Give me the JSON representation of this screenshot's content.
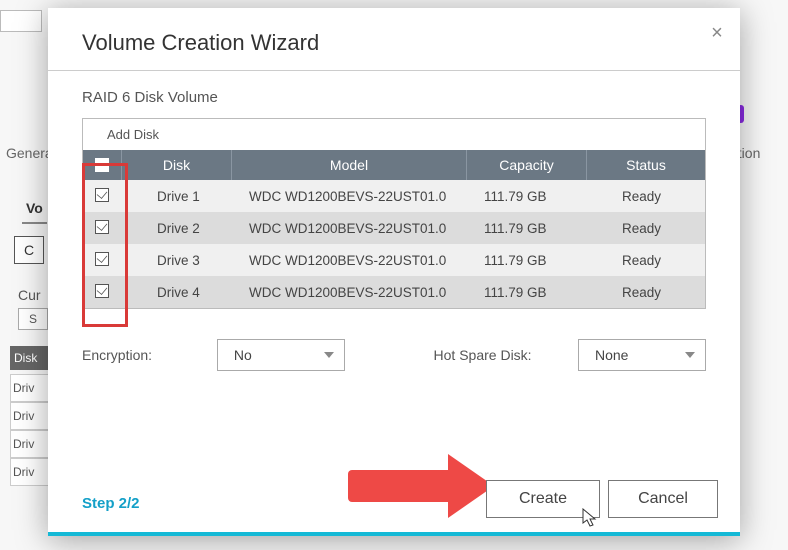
{
  "bg": {
    "general_label_fragment": "Genera",
    "ation_fragment": "ation",
    "vol_tab_fragment": "Vo",
    "c_button_fragment": "C",
    "curr_fragment": "Cur",
    "s_fragment": "S",
    "disk_fragment": "Disk",
    "drive_fragment": "Driv"
  },
  "dialog": {
    "title": "Volume Creation Wizard",
    "subtitle": "RAID 6 Disk Volume",
    "add_disk_label": "Add Disk",
    "columns": {
      "disk": "Disk",
      "model": "Model",
      "capacity": "Capacity",
      "status": "Status"
    },
    "select_all_checked": true,
    "rows": [
      {
        "checked": true,
        "disk": "Drive 1",
        "model": "WDC WD1200BEVS-22UST01.0",
        "capacity": "111.79 GB",
        "status": "Ready"
      },
      {
        "checked": true,
        "disk": "Drive 2",
        "model": "WDC WD1200BEVS-22UST01.0",
        "capacity": "111.79 GB",
        "status": "Ready"
      },
      {
        "checked": true,
        "disk": "Drive 3",
        "model": "WDC WD1200BEVS-22UST01.0",
        "capacity": "111.79 GB",
        "status": "Ready"
      },
      {
        "checked": true,
        "disk": "Drive 4",
        "model": "WDC WD1200BEVS-22UST01.0",
        "capacity": "111.79 GB",
        "status": "Ready"
      }
    ],
    "encryption_label": "Encryption:",
    "encryption_value": "No",
    "hotspare_label": "Hot Spare Disk:",
    "hotspare_value": "None",
    "step_label": "Step 2/2",
    "create_label": "Create",
    "cancel_label": "Cancel"
  },
  "colors": {
    "accent_teal": "#14b9d6",
    "header_bg": "#6b7884",
    "highlight_red": "#d93a38",
    "arrow_red": "#ee4946"
  }
}
